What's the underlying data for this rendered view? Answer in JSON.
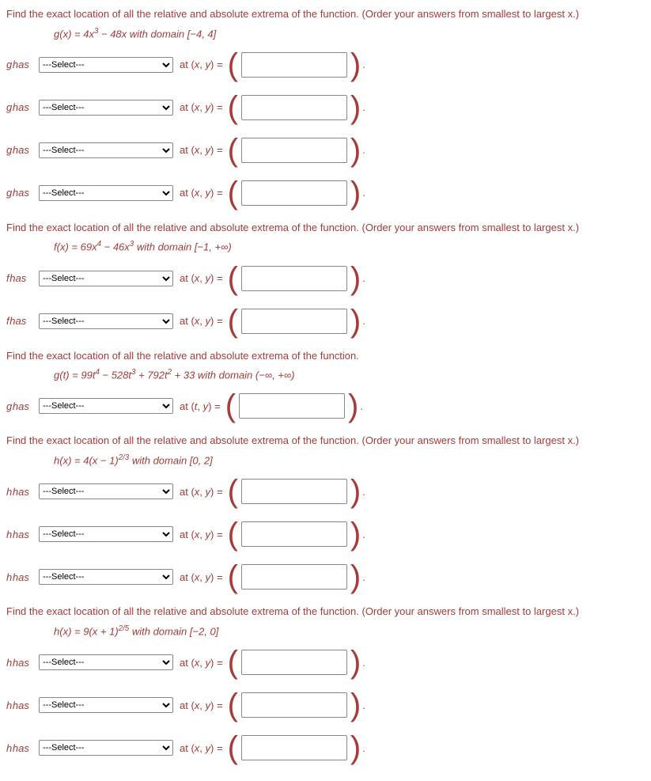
{
  "problems": [
    {
      "prompt": "Find the exact location of all the relative and absolute extrema of the function. (Order your answers from smallest to largest x.)",
      "equation_html": "<i>g</i>(<i>x</i>) = 4<i>x</i><sup>3</sup> − 48<i>x</i> with domain [−4, 4]",
      "func_letter": "g",
      "at_var": "at (x, y) =",
      "rows": 4
    },
    {
      "prompt": "Find the exact location of all the relative and absolute extrema of the function. (Order your answers from smallest to largest x.)",
      "equation_html": "<i>f</i>(<i>x</i>) = 69<i>x</i><sup>4</sup> − 46<i>x</i><sup>3</sup> with domain [−1, +∞)",
      "func_letter": "f",
      "at_var": "at (x, y) =",
      "rows": 2
    },
    {
      "prompt": "Find the exact location of all the relative and absolute extrema of the function.",
      "equation_html": "<i>g</i>(<i>t</i>) = 99<i>t</i><sup>4</sup> − 528<i>t</i><sup>3</sup> + 792<i>t</i><sup>2</sup> + 33 with domain (−∞, +∞)",
      "func_letter": "g",
      "at_var": "at (t, y) =",
      "rows": 1
    },
    {
      "prompt": "Find the exact location of all the relative and absolute extrema of the function. (Order your answers from smallest to largest x.)",
      "equation_html": "<i>h</i>(<i>x</i>) = 4(<i>x</i> − 1)<sup>2/3</sup> with domain [0, 2]",
      "func_letter": "h",
      "at_var": "at (x, y) =",
      "rows": 3
    },
    {
      "prompt": "Find the exact location of all the relative and absolute extrema of the function. (Order your answers from smallest to largest x.)",
      "equation_html": "<i>h</i>(<i>x</i>) = 9(<i>x</i> + 1)<sup>2/5</sup> with domain [−2, 0]",
      "func_letter": "h",
      "at_var": "at (x, y) =",
      "rows": 3
    }
  ],
  "labels": {
    "has": "has",
    "select_placeholder": "---Select---",
    "period": "."
  }
}
